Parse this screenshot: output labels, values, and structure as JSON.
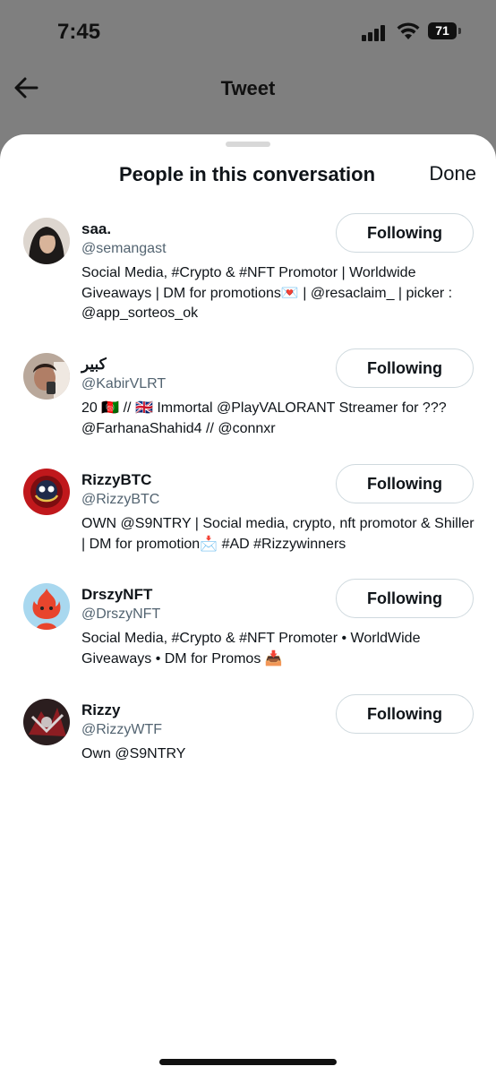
{
  "status_bar": {
    "time": "7:45",
    "battery": "71"
  },
  "tweet_header": {
    "title": "Tweet",
    "behind_text": ""
  },
  "sheet": {
    "title": "People in this conversation",
    "done_label": "Done"
  },
  "people": [
    {
      "name": "saa.",
      "handle": "@semangast",
      "bio": "Social Media, #Crypto & #NFT Promotor | Worldwide Giveaways | DM for promotions💌 | @resaclaim_ | picker : @app_sorteos_ok",
      "button": "Following",
      "avatar_color": "#3a3a3a"
    },
    {
      "name": "كبير",
      "handle": "@KabirVLRT",
      "bio": "20 🇦🇫 // 🇬🇧 Immortal @PlayVALORANT Streamer for ??? @FarhanaShahid4 // @connxr",
      "button": "Following",
      "avatar_color": "#8a6b5a"
    },
    {
      "name": "RizzyBTC",
      "handle": "@RizzyBTC",
      "bio": "OWN @S9NTRY | Social media, crypto, nft promotor & Shiller | DM for promotion📩 #AD #Rizzywinners",
      "button": "Following",
      "avatar_color": "#c0181c"
    },
    {
      "name": "DrszyNFT",
      "handle": "@DrszyNFT",
      "bio": "Social Media, #Crypto & #NFT Promoter • WorldWide Giveaways • DM for Promos 📥",
      "button": "Following",
      "avatar_color": "#a9d8ef"
    },
    {
      "name": "Rizzy",
      "handle": "@RizzyWTF",
      "bio": "Own @S9NTRY",
      "button": "Following",
      "avatar_color": "#3a2a2a"
    }
  ]
}
